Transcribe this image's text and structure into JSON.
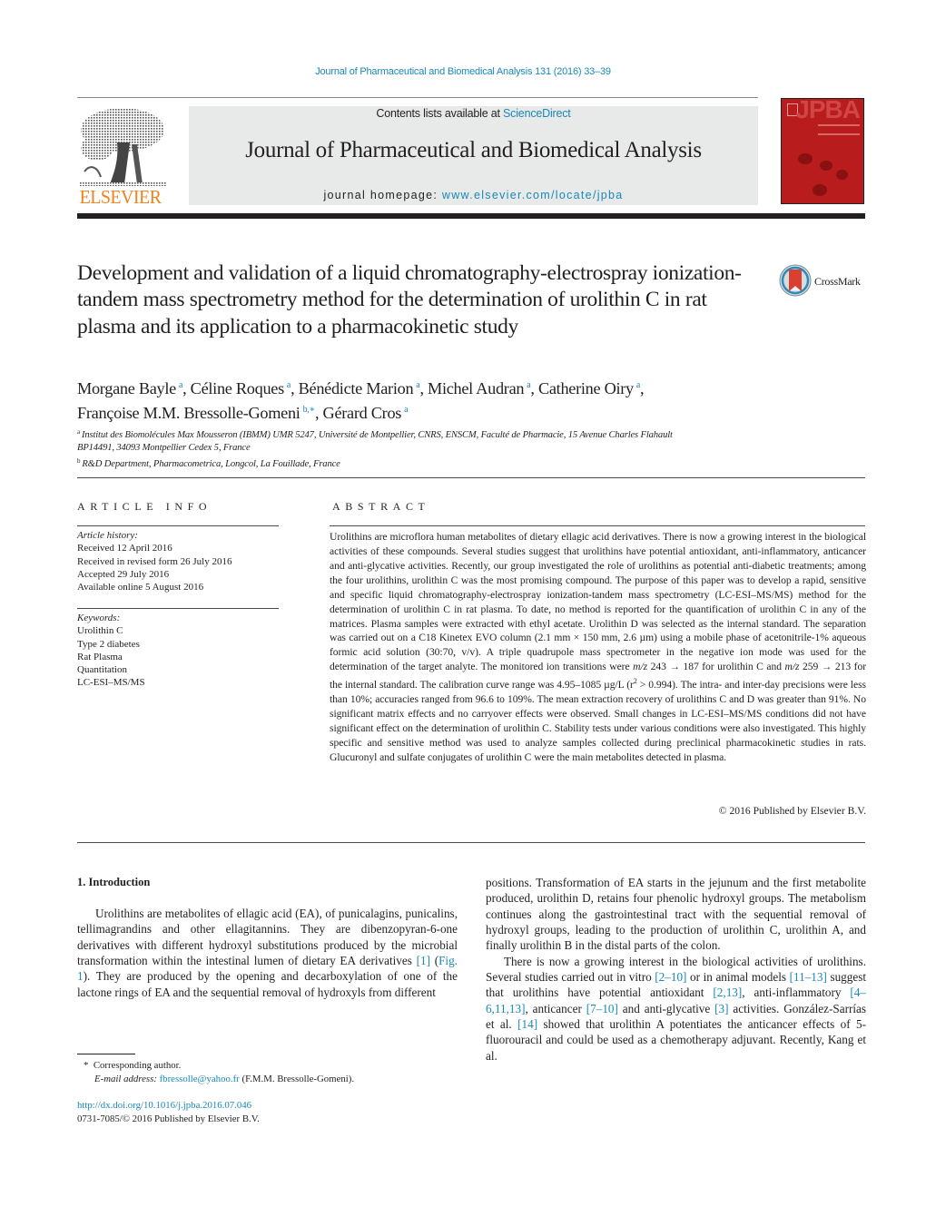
{
  "header": {
    "running_head": "Journal of Pharmaceutical and Biomedical Analysis 131 (2016) 33–39",
    "contents_prefix": "Contents lists available at ",
    "contents_link": "ScienceDirect",
    "journal_title": "Journal of Pharmaceutical and Biomedical Analysis",
    "homepage_prefix": "journal homepage: ",
    "homepage_link": "www.elsevier.com/locate/jpba",
    "publisher_logo_text": "ELSEVIER",
    "cover_title": "JPBA",
    "publisher_color": "#f0821e",
    "link_color": "#1a88b8",
    "cover_color": "#b81c1c"
  },
  "article": {
    "title": "Development and validation of a liquid chromatography-electrospray ionization-tandem mass spectrometry method for the determination of urolithin C in rat plasma and its application to a pharmacokinetic study",
    "crossmark_label": "CrossMark",
    "authors": [
      {
        "name": "Morgane Bayle",
        "sup": "a",
        "sep": ", "
      },
      {
        "name": "Céline Roques",
        "sup": "a",
        "sep": ", "
      },
      {
        "name": "Bénédicte Marion",
        "sup": "a",
        "sep": ", "
      },
      {
        "name": "Michel Audran",
        "sup": "a",
        "sep": ", "
      },
      {
        "name": "Catherine Oiry",
        "sup": "a",
        "sep": ","
      },
      {
        "name": "Françoise M.M. Bressolle-Gomeni",
        "sup": "b,∗",
        "sep": ", "
      },
      {
        "name": "Gérard Cros",
        "sup": "a",
        "sep": ""
      }
    ],
    "affiliations": [
      {
        "mark": "a",
        "text": "Institut des Biomolécules Max Mousseron (IBMM) UMR 5247, Université de Montpellier, CNRS, ENSCM, Faculté de Pharmacie, 15 Avenue Charles Flahault",
        "text2": "BP14491, 34093 Montpellier Cedex 5, France"
      },
      {
        "mark": "b",
        "text": "R&D Department, Pharmacometrica, Longcol, La Fouillade, France"
      }
    ]
  },
  "article_info": {
    "heading": "ARTICLE INFO",
    "history_label": "Article history:",
    "history": [
      "Received 12 April 2016",
      "Received in revised form 26 July 2016",
      "Accepted 29 July 2016",
      "Available online 5 August 2016"
    ],
    "keywords_label": "Keywords:",
    "keywords": [
      "Urolithin C",
      "Type 2 diabetes",
      "Rat Plasma",
      "Quantitation",
      "LC-ESI–MS/MS"
    ]
  },
  "abstract": {
    "heading": "ABSTRACT",
    "text_1": "Urolithins are microflora human metabolites of dietary ellagic acid derivatives. There is now a growing interest in the biological activities of these compounds. Several studies suggest that urolithins have potential antioxidant, anti-inflammatory, anticancer and anti-glycative activities. Recently, our group investigated the role of urolithins as potential anti-diabetic treatments; among the four urolithins, urolithin C was the most promising compound. The purpose of this paper was to develop a rapid, sensitive and specific liquid chromatography-electrospray ionization-tandem mass spectrometry (LC-ESI–MS/MS) method for the determination of urolithin C in rat plasma. To date, no method is reported for the quantification of urolithin C in any of the matrices. Plasma samples were extracted with ethyl acetate. Urolithin D was selected as the internal standard. The separation was carried out on a C18 Kinetex EVO column (2.1 mm × 150 mm, 2.6 µm) using a mobile phase of acetonitrile-1% aqueous formic acid solution (30:70, v/v). A triple quadrupole mass spectrometer in the negative ion mode was used for the determination of the target analyte. The monitored ion transitions were ",
    "mz": "m/z",
    "transition_1": " 243 → 187 for urolithin C and ",
    "transition_2": " 259 → 213 for the internal standard. The calibration curve range was 4.95–1085 µg/L (r",
    "r2_sup": "2",
    "text_2": " > 0.994). The intra- and inter-day precisions were less than 10%; accuracies ranged from 96.6 to 109%. The mean extraction recovery of urolithins C and D was greater than 91%. No significant matrix effects and no carryover effects were observed. Small changes in LC-ESI–MS/MS conditions did not have significant effect on the determination of urolithin C. Stability tests under various conditions were also investigated. This highly specific and sensitive method was used to analyze samples collected during preclinical pharmacokinetic studies in rats. Glucuronyl and sulfate conjugates of urolithin C were the main metabolites detected in plasma.",
    "copyright": "© 2016 Published by Elsevier B.V."
  },
  "introduction": {
    "heading": "1.  Introduction",
    "p1_a": "Urolithins are metabolites of ellagic acid (EA), of punicalagins, punicalins, tellimagrandins and other ellagitannins. They are dibenzopyran-6-one derivatives with different hydroxyl substitutions produced by the microbial transformation within the intestinal lumen of dietary EA derivatives ",
    "p1_ref1": "[1]",
    "p1_b": " (",
    "p1_fig": "Fig. 1",
    "p1_c": "). They are produced by the opening and decarboxylation of one of the lactone rings of EA and the sequential removal of hydroxyls from different ",
    "p1_cont": "positions. Transformation of EA starts in the jejunum and the first metabolite produced, urolithin D, retains four phenolic hydroxyl groups. The metabolism continues along the gastrointestinal tract with the sequential removal of hydroxyl groups, leading to the production of urolithin C, urolithin A, and finally urolithin B in the distal parts of the colon.",
    "p2_a": "There is now a growing interest in the biological activities of urolithins. Several studies carried out in vitro ",
    "p2_r1": "[2–10]",
    "p2_b": " or in animal models ",
    "p2_r2": "[11–13]",
    "p2_c": " suggest that urolithins have potential antioxidant ",
    "p2_r3": "[2,13]",
    "p2_d": ", anti-inflammatory ",
    "p2_r4": "[4–6,11,13]",
    "p2_e": ", anticancer ",
    "p2_r5": "[7–10]",
    "p2_f": " and anti-glycative ",
    "p2_r6": "[3]",
    "p2_g": " activities. González-Sarrías et al. ",
    "p2_r7": "[14]",
    "p2_h": " showed that urolithin A potentiates the anticancer effects of 5-fluorouracil and could be used as a chemotherapy adjuvant. Recently, Kang et al."
  },
  "footnote": {
    "star": "*",
    "corresponding": "Corresponding author.",
    "email_label": "E-mail address:",
    "email": "fbressolle@yahoo.fr",
    "email_owner": " (F.M.M. Bressolle-Gomeni).",
    "doi": "http://dx.doi.org/10.1016/j.jpba.2016.07.046",
    "issn": "0731-7085/© 2016 Published by Elsevier B.V."
  }
}
